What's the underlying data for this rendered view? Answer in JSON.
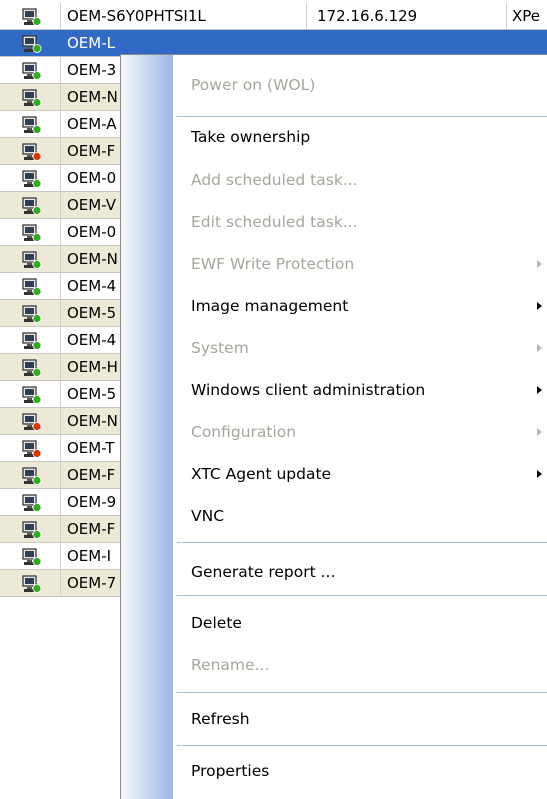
{
  "device_list": {
    "rows": [
      {
        "name": "OEM-S6Y0PHTSI1L",
        "ip": "172.16.6.129",
        "os": "XPe",
        "status": "ok"
      },
      {
        "name": "OEM-L",
        "ip": "",
        "os": "",
        "status": "ok",
        "selected": true
      },
      {
        "name": "OEM-3",
        "status": "ok"
      },
      {
        "name": "OEM-N",
        "status": "ok"
      },
      {
        "name": "OEM-A",
        "status": "ok"
      },
      {
        "name": "OEM-F",
        "status": "error"
      },
      {
        "name": "OEM-0",
        "status": "ok"
      },
      {
        "name": "OEM-V",
        "status": "ok"
      },
      {
        "name": "OEM-0",
        "status": "ok"
      },
      {
        "name": "OEM-N",
        "status": "ok"
      },
      {
        "name": "OEM-4",
        "status": "ok"
      },
      {
        "name": "OEM-5",
        "status": "ok"
      },
      {
        "name": "OEM-4",
        "status": "ok"
      },
      {
        "name": "OEM-H",
        "status": "ok"
      },
      {
        "name": "OEM-5",
        "status": "ok"
      },
      {
        "name": "OEM-N",
        "status": "error"
      },
      {
        "name": "OEM-T",
        "status": "error"
      },
      {
        "name": "OEM-F",
        "status": "ok"
      },
      {
        "name": "OEM-9",
        "status": "ok"
      },
      {
        "name": "OEM-F",
        "status": "ok"
      },
      {
        "name": "OEM-I",
        "status": "ok"
      },
      {
        "name": "OEM-7",
        "status": "ok"
      }
    ]
  },
  "context_menu": {
    "items": [
      {
        "label": "Power on (WOL)",
        "disabled": true,
        "submenu": false
      },
      {
        "label": "Take ownership",
        "disabled": false,
        "submenu": false
      },
      {
        "label": "Add scheduled task...",
        "disabled": true,
        "submenu": false
      },
      {
        "label": "Edit scheduled task...",
        "disabled": true,
        "submenu": false
      },
      {
        "label": "EWF Write Protection",
        "disabled": true,
        "submenu": true
      },
      {
        "label": "Image management",
        "disabled": false,
        "submenu": true
      },
      {
        "label": "System",
        "disabled": true,
        "submenu": true
      },
      {
        "label": "Windows client administration",
        "disabled": false,
        "submenu": true
      },
      {
        "label": "Configuration",
        "disabled": true,
        "submenu": true
      },
      {
        "label": "XTC Agent update",
        "disabled": false,
        "submenu": true
      },
      {
        "label": "VNC",
        "disabled": false,
        "submenu": false
      },
      {
        "label": "Generate report ...",
        "disabled": false,
        "submenu": false
      },
      {
        "label": "Delete",
        "disabled": false,
        "submenu": false
      },
      {
        "label": "Rename...",
        "disabled": true,
        "submenu": false
      },
      {
        "label": "Refresh",
        "disabled": false,
        "submenu": false
      },
      {
        "label": "Properties",
        "disabled": false,
        "submenu": false
      }
    ]
  },
  "colors": {
    "selection": "#316ac5",
    "alt_row": "#ecead6",
    "status_ok": "#33aa22",
    "status_error": "#dd3300"
  }
}
